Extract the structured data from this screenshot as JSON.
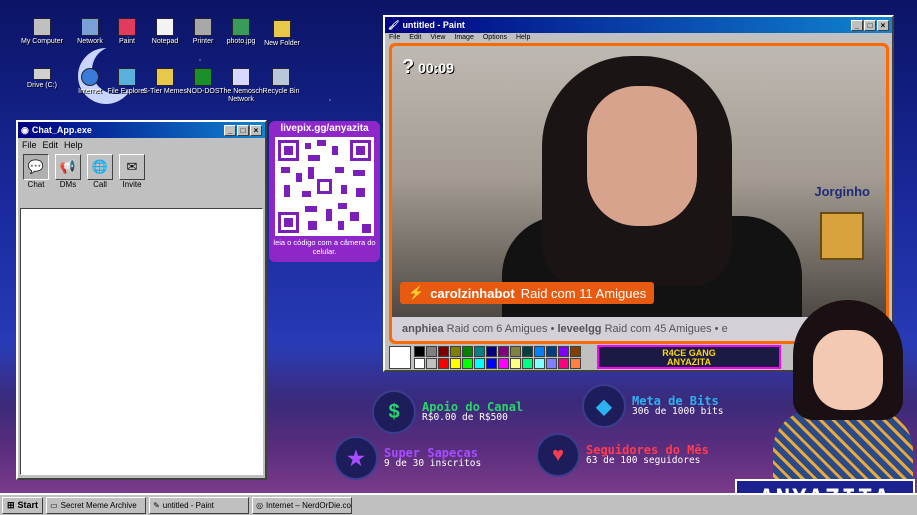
{
  "desktop_icons": [
    {
      "label": "My Computer",
      "icon": "computer-icon"
    },
    {
      "label": "Network",
      "icon": "network-icon"
    },
    {
      "label": "Paint",
      "icon": "paint-icon"
    },
    {
      "label": "Notepad",
      "icon": "notepad-icon"
    },
    {
      "label": "Printer",
      "icon": "printer-icon"
    },
    {
      "label": "photo.jpg",
      "icon": "image-file-icon"
    },
    {
      "label": "New Folder",
      "icon": "folder-icon"
    },
    {
      "label": "Drive (C:)",
      "icon": "drive-icon"
    },
    {
      "label": "Internet",
      "icon": "internet-icon"
    },
    {
      "label": "File Explorer",
      "icon": "file-explorer-icon"
    },
    {
      "label": "S-Tier Memes",
      "icon": "memes-folder-icon"
    },
    {
      "label": "NOD-DOS",
      "icon": "nod-dos-icon"
    },
    {
      "label": "The Nemosch Network",
      "icon": "nemosch-network-icon"
    },
    {
      "label": "Recycle Bin",
      "icon": "recycle-bin-icon"
    }
  ],
  "chat_window": {
    "title": "Chat_App.exe",
    "menu": [
      "File",
      "Edit",
      "Help"
    ],
    "tools": [
      "Chat",
      "DMs",
      "Call",
      "Invite"
    ]
  },
  "qr_panel": {
    "url": "livepix.gg/anyazita",
    "caption": "leia o código com a câmera do celular."
  },
  "paint_window": {
    "title": "untitled - Paint",
    "menu": [
      "File",
      "Edit",
      "View",
      "Image",
      "Options",
      "Help"
    ]
  },
  "stream": {
    "timer": "00:09",
    "pet_name": "Jorginho",
    "raid_user": "carolzinhabot",
    "raid_text": "Raid com 11 Amigues",
    "ticker": [
      {
        "user": "anphiea",
        "text": "Raid com 6 Amigues"
      },
      {
        "user": "leveelgg",
        "text": "Raid com 45 Amigues"
      }
    ],
    "ticker_trail": "e",
    "badge_line1": "R4CE GANG",
    "badge_line2": "ANYAZITA"
  },
  "palette_colors": [
    "#000000",
    "#808080",
    "#800000",
    "#808000",
    "#008000",
    "#008080",
    "#000080",
    "#800080",
    "#808040",
    "#004040",
    "#0080ff",
    "#004080",
    "#8000ff",
    "#804000",
    "#ffffff",
    "#c0c0c0",
    "#ff0000",
    "#ffff00",
    "#00ff00",
    "#00ffff",
    "#0000ff",
    "#ff00ff",
    "#ffff80",
    "#00ff80",
    "#80ffff",
    "#8080ff",
    "#ff0080",
    "#ff8040"
  ],
  "goals": {
    "support": {
      "title": "Apoio do Canal",
      "detail": "R$0.00 de R$500",
      "color": "#27d66b"
    },
    "bits": {
      "title": "Meta de Bits",
      "detail": "306 de 1000 bits",
      "color": "#2ab3f0"
    },
    "subs": {
      "title": "Super Sapecas",
      "detail": "9 de 30 inscritos",
      "color": "#a64dff"
    },
    "followers": {
      "title": "Seguidores do Mês",
      "detail": "63 de 100 seguidores",
      "color": "#ff3b4e"
    }
  },
  "brand": "ANYAZITA",
  "taskbar": {
    "start": "Start",
    "tasks": [
      "Secret Meme Archive",
      "untitled - Paint",
      "Internet – NerdOrDie.com"
    ]
  }
}
